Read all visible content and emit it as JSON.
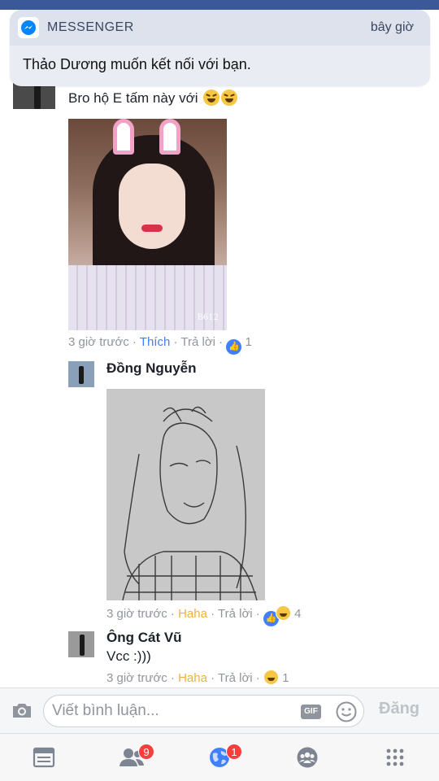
{
  "notification": {
    "app": "MESSENGER",
    "time": "bây giờ",
    "message": "Thảo Dương muốn kết nối với bạn."
  },
  "comments": [
    {
      "text": "Bro hộ E tấm này với",
      "time": "3 giờ trước",
      "reaction_action": "Thích",
      "reply": "Trả lời",
      "reaction_count": "1",
      "photo_watermark": "B612"
    },
    {
      "author": "Đồng Nguyễn",
      "time": "3 giờ trước",
      "reaction_action": "Haha",
      "reply": "Trả lời",
      "reaction_count": "4"
    },
    {
      "author": "Ông Cát Vũ",
      "text": "Vcc :)))",
      "time": "3 giờ trước",
      "reaction_action": "Haha",
      "reply": "Trả lời",
      "reaction_count": "1"
    }
  ],
  "composer": {
    "placeholder": "Viết bình luận...",
    "gif_label": "GIF",
    "post_label": "Đăng"
  },
  "tabbar": {
    "friend_requests_badge": "9",
    "notifications_badge": "1"
  },
  "colors": {
    "facebook_blue": "#3b5998",
    "like_blue": "#4080ff",
    "haha_yellow": "#f0b13b",
    "badge_red": "#fa3e3e"
  }
}
